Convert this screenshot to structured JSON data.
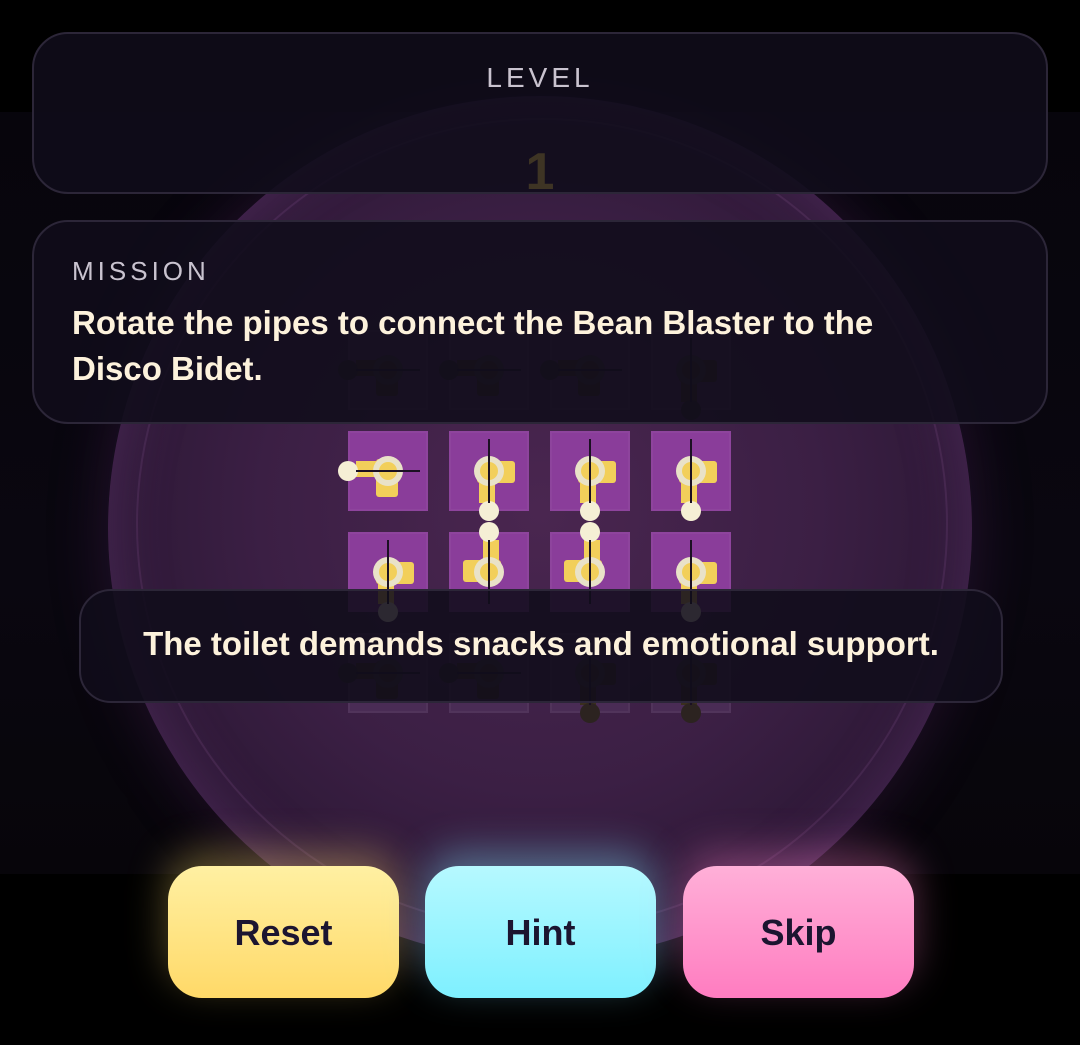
{
  "level": {
    "label": "LEVEL",
    "number": "1"
  },
  "mission": {
    "label": "MISSION",
    "text": "Rotate the pipes to connect the Bean Blaster to the Disco Bidet."
  },
  "toast": {
    "text": "The toilet demands snacks and emotional support."
  },
  "buttons": {
    "reset": "Reset",
    "hint": "Hint",
    "skip": "Skip"
  },
  "board": {
    "rows": 4,
    "cols": 4,
    "tiles": [
      [
        {
          "pipe": "pipe-tee-icon",
          "lit": false
        },
        {
          "pipe": "pipe-tee-icon",
          "lit": false
        },
        {
          "pipe": "pipe-tee-icon",
          "lit": false
        },
        {
          "pipe": "pipe-tee-icon",
          "lit": false
        }
      ],
      [
        {
          "pipe": "pipe-tee-icon",
          "lit": true
        },
        {
          "pipe": "pipe-tee-icon",
          "lit": true
        },
        {
          "pipe": "pipe-tee-icon",
          "lit": true
        },
        {
          "pipe": "pipe-tee-icon",
          "lit": true
        }
      ],
      [
        {
          "pipe": "pipe-tee-icon",
          "lit": true
        },
        {
          "pipe": "pipe-tee-icon",
          "lit": true
        },
        {
          "pipe": "pipe-tee-icon",
          "lit": true
        },
        {
          "pipe": "pipe-elbow-icon",
          "lit": true
        }
      ],
      [
        {
          "pipe": "pipe-tee-icon",
          "lit": false
        },
        {
          "pipe": "pipe-tee-icon",
          "lit": false
        },
        {
          "pipe": "pipe-tee-icon",
          "lit": false
        },
        {
          "pipe": "pipe-tee-icon",
          "lit": false
        }
      ]
    ]
  },
  "colors": {
    "tile": "#8a3d9a",
    "tile_dim": "#4a2c55",
    "pipe": "#f2cf5a",
    "pipe_dim": "#3a2f1e",
    "reset": "#ffd968",
    "hint": "#7ef0ff",
    "skip": "#ff7cc0"
  }
}
